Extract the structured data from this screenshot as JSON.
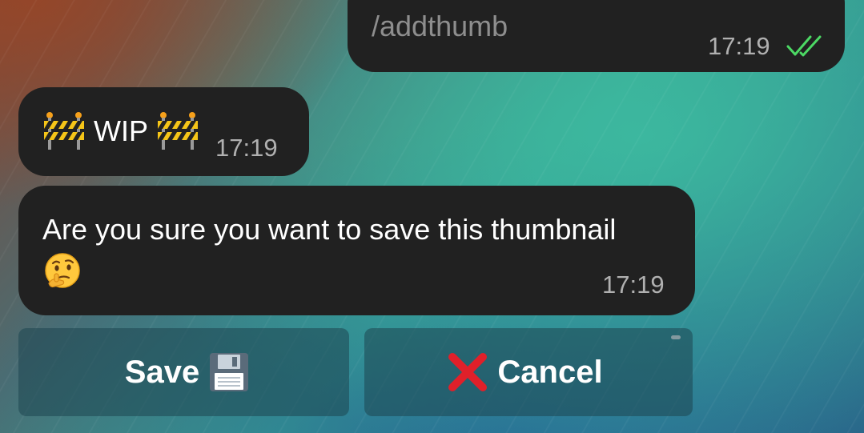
{
  "messages": {
    "outgoing": {
      "text": "/addthumb",
      "time": "17:19",
      "status_icon": "double-check-icon",
      "status_color": "#4cd964"
    },
    "wip": {
      "label": "WIP",
      "time": "17:19",
      "icons": [
        "construction-barrier-icon",
        "construction-barrier-icon"
      ]
    },
    "confirm": {
      "text": "Are you sure you want to save this thumbnail",
      "emoji": "thinking-face-icon",
      "time": "17:19"
    }
  },
  "keyboard": {
    "save_label": "Save",
    "save_icon": "floppy-disk-icon",
    "cancel_label": "Cancel",
    "cancel_icon": "red-cross-icon",
    "cancel_icon_color": "#e0202a"
  },
  "colors": {
    "bubble_bg": "#212121",
    "time_text": "#b0b0b0",
    "command_text": "#8e8e8e"
  }
}
